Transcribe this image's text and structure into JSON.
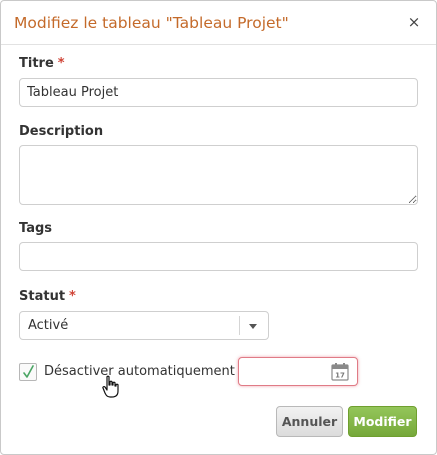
{
  "dialog": {
    "title": "Modifiez le tableau \"Tableau Projet\"",
    "close_icon": "close-icon",
    "close_glyph": "×"
  },
  "form": {
    "title_label": "Titre",
    "required_mark": "*",
    "title_value": "Tableau Projet",
    "description_label": "Description",
    "description_value": "",
    "tags_label": "Tags",
    "tags_value": "",
    "status_label": "Statut",
    "status_value": "Activé",
    "auto_deactivate_checked": true,
    "auto_deactivate_label": "Désactiver automatiquement le",
    "auto_deactivate_date": "",
    "calendar_icon": "calendar-icon",
    "calendar_day": "17"
  },
  "buttons": {
    "cancel_label": "Annuler",
    "submit_label": "Modifier"
  },
  "colors": {
    "title": "#c46a2a",
    "required": "#d04437",
    "submit": "#7fb043",
    "date_error_border": "#e07b86"
  }
}
